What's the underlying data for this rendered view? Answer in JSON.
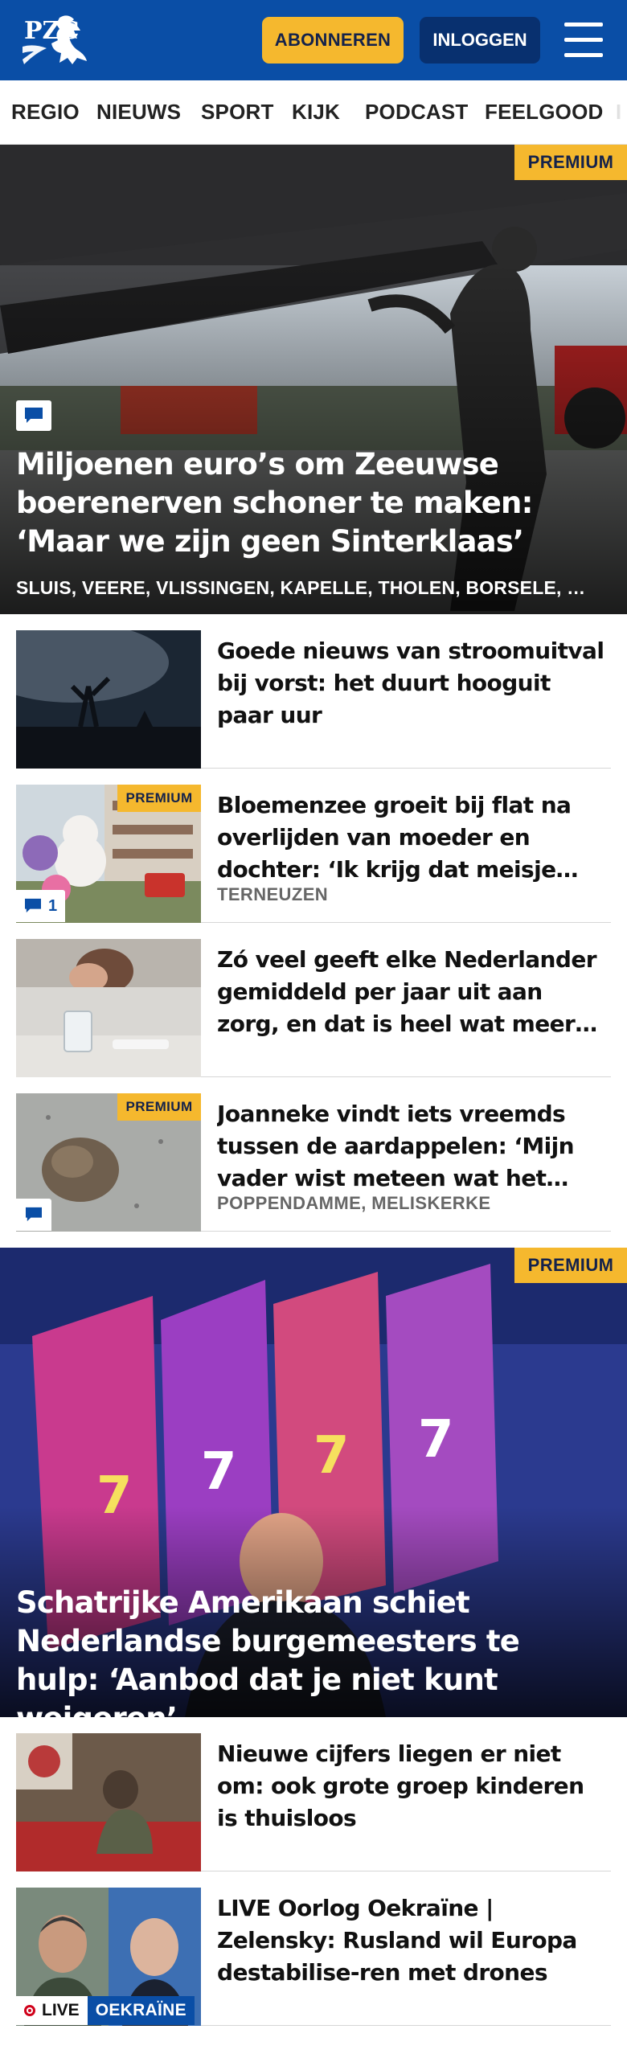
{
  "header": {
    "logo_text": "PZC",
    "subscribe_label": "ABONNEREN",
    "login_label": "INLOGGEN",
    "menu_icon": "hamburger-menu-icon",
    "brand_color": "#0a4ea6",
    "accent_color": "#f5b82e"
  },
  "nav": {
    "items": [
      "REGIO",
      "NIEUWS",
      "SPORT",
      "KIJK",
      "PODCAST",
      "FEELGOOD",
      "I"
    ]
  },
  "hero1": {
    "badge": "PREMIUM",
    "title": "Miljoenen euro’s om Zeeuwse boerenerven schoner te maken: ‘Maar we zijn geen Sinterklaas’",
    "places": "SLUIS, VEERE, VLISSINGEN, KAPELLE, THOLEN, BORSELE, …",
    "comment_icon": "comment-icon"
  },
  "articles": [
    {
      "title": "Goede nieuws van stroomuitval bij vorst: het duurt hooguit paar uur"
    },
    {
      "badge": "PREMIUM",
      "title": "Bloemenzee groeit bij flat na overlijden van moeder en dochter: ‘Ik krijg dat meisje niet uit mijn hoofd’",
      "place": "TERNEUZEN",
      "comments": "1"
    },
    {
      "title": "Zó veel geeft elke Nederlander gemiddeld per jaar uit aan zorg, en dat is heel wat meer dan een jaar geleden"
    },
    {
      "badge": "PREMIUM",
      "title": "Joanneke vindt iets vreemds tussen de aardappelen: ‘Mijn vader wist meteen wat het was’",
      "place": "POPPENDAMME, MELISKERKE"
    }
  ],
  "hero2": {
    "badge": "PREMIUM",
    "title": "Schatrijke Amerikaan schiet Nederlandse burgemeesters te hulp: ‘Aanbod dat je niet kunt weigeren’"
  },
  "articles2": [
    {
      "title": "Nieuwe cijfers liegen er niet om: ook grote groep kinderen is thuisloos"
    },
    {
      "title": "LIVE Oorlog Oekraïne | Zelensky: Rusland wil Europa destabilise-ren met drones",
      "live_label": "LIVE",
      "topic": "OEKRAÏNE"
    }
  ]
}
